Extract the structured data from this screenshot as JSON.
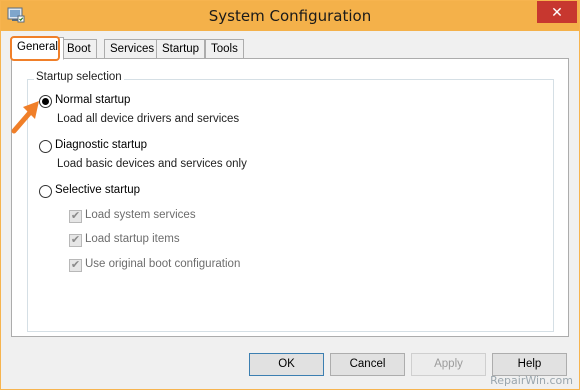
{
  "window": {
    "title": "System Configuration",
    "close_label": "✕",
    "accent": "#f4b14a"
  },
  "tabs": [
    {
      "label": "General",
      "active": true
    },
    {
      "label": "Boot"
    },
    {
      "label": "Services"
    },
    {
      "label": "Startup"
    },
    {
      "label": "Tools"
    }
  ],
  "startup_selection": {
    "label": "Startup selection",
    "options": [
      {
        "label": "Normal startup",
        "description": "Load all device drivers and services",
        "selected": true
      },
      {
        "label": "Diagnostic startup",
        "description": "Load basic devices and services only",
        "selected": false
      },
      {
        "label": "Selective startup",
        "description": "",
        "selected": false
      }
    ],
    "selective_items": [
      {
        "label": "Load system services",
        "checked": true,
        "disabled": true
      },
      {
        "label": "Load startup items",
        "checked": true,
        "disabled": true
      },
      {
        "label": "Use original boot configuration",
        "checked": true,
        "disabled": true
      }
    ]
  },
  "buttons": {
    "ok": "OK",
    "cancel": "Cancel",
    "apply": "Apply",
    "help": "Help"
  },
  "watermark": "RepairWin.com",
  "annotation_color": "#f07f29"
}
